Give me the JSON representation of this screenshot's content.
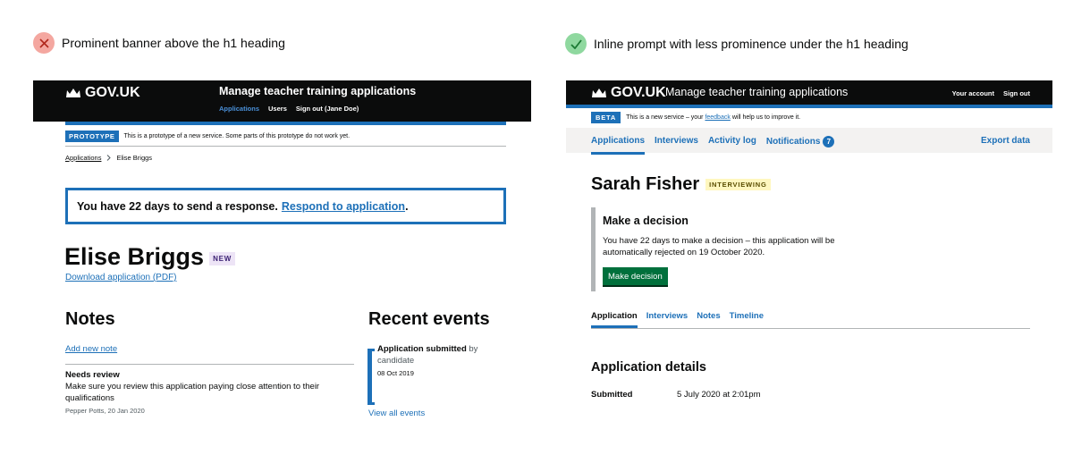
{
  "captions": {
    "bad": "Prominent banner above the h1 heading",
    "good": "Inline prompt with less prominence under the h1 heading"
  },
  "colors": {
    "bad_badge": "#f4a7a0",
    "good_badge": "#8fd89f",
    "govuk_blue": "#1d70b8",
    "header_black": "#0b0c0c",
    "button_green": "#00703c"
  },
  "left": {
    "logo": "GOV.UK",
    "service": "Manage teacher training applications",
    "nav": [
      "Applications",
      "Users",
      "Sign out (Jane Doe)"
    ],
    "phase_tag": "PROTOTYPE",
    "phase_text": "This is a prototype of a new service. Some parts of this prototype do not work yet.",
    "breadcrumbs": [
      "Applications",
      "Elise Briggs"
    ],
    "banner_text": "You have 22 days to send a response.",
    "banner_link": "Respond to application",
    "banner_end": ".",
    "name": "Elise Briggs",
    "name_tag": "NEW",
    "download": "Download application (PDF)",
    "notes_heading": "Notes",
    "add_note": "Add new note",
    "note": {
      "title": "Needs review",
      "body": "Make sure you review this application paying close attention to their qualifications",
      "meta": "Pepper Potts, 20 Jan 2020"
    },
    "events_heading": "Recent events",
    "event": {
      "title": "Application submitted",
      "by": " by candidate",
      "date": "08 Oct 2019"
    },
    "view_all": "View all events"
  },
  "right": {
    "logo": "GOV.UK",
    "service": "Manage teacher training applications",
    "account": [
      "Your account",
      "Sign out"
    ],
    "phase_tag": "BETA",
    "phase_pre": "This is a new service – your",
    "phase_link": "feedback",
    "phase_post": "will help us to improve it.",
    "nav": [
      "Applications",
      "Interviews",
      "Activity log",
      "Notifications"
    ],
    "notifications_count": "7",
    "export": "Export data",
    "name": "Sarah Fisher",
    "status_tag": "INTERVIEWING",
    "decision_heading": "Make a decision",
    "decision_text": "You have 22 days to make a decision – this application will be automatically rejected on 19 October 2020.",
    "decision_button": "Make decision",
    "tabs": [
      "Application",
      "Interviews",
      "Notes",
      "Timeline"
    ],
    "details_heading": "Application details",
    "submitted_label": "Submitted",
    "submitted_value": "5 July 2020 at 2:01pm"
  }
}
